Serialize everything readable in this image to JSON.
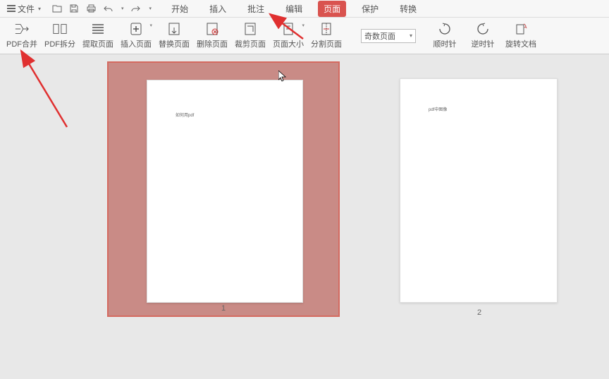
{
  "menu": {
    "file_label": "文件"
  },
  "tabs": {
    "start": "开始",
    "insert": "插入",
    "comment": "批注",
    "edit": "编辑",
    "page": "页面",
    "protect": "保护",
    "convert": "转换"
  },
  "ribbon": {
    "merge": "PDF合并",
    "split": "PDF拆分",
    "extract": "提取页面",
    "insert_page": "插入页面",
    "replace": "替换页面",
    "delete": "删除页面",
    "crop": "裁剪页面",
    "page_size": "页面大小",
    "split_page": "分割页面",
    "cw": "顺时针",
    "ccw": "逆时针",
    "rotate_doc": "旋转文档"
  },
  "select": {
    "value": "奇数页面"
  },
  "pages": {
    "p1": {
      "num": "1",
      "text": "如何用pdf"
    },
    "p2": {
      "num": "2",
      "text": "pdf中图像"
    }
  }
}
